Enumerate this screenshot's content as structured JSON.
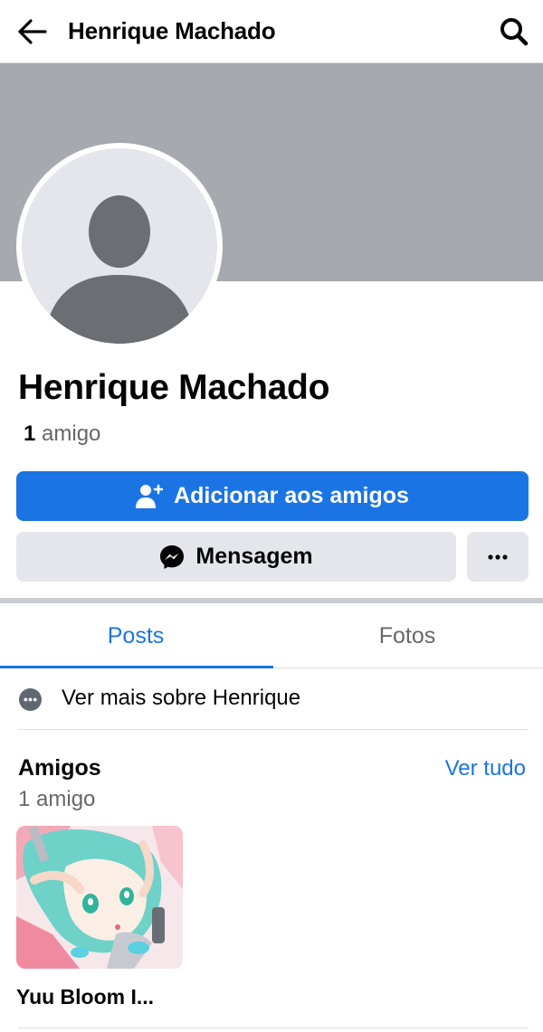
{
  "header": {
    "title": "Henrique Machado",
    "back_icon": "arrow-left-icon",
    "search_icon": "search-icon"
  },
  "profile": {
    "name": "Henrique Machado",
    "friend_count_number": "1",
    "friend_count_word": "amigo",
    "cover_color": "#a6a9ae",
    "avatar_icon": "default-avatar-icon"
  },
  "actions": {
    "add_friend_label": "Adicionar aos amigos",
    "add_friend_icon": "person-add-icon",
    "message_label": "Mensagem",
    "message_icon": "messenger-icon",
    "more_icon": "ellipsis-icon"
  },
  "tabs": [
    {
      "label": "Posts",
      "active": true
    },
    {
      "label": "Fotos",
      "active": false
    }
  ],
  "about": {
    "label": "Ver mais sobre Henrique",
    "icon": "ellipsis-circle-icon"
  },
  "friends": {
    "title": "Amigos",
    "see_all_label": "Ver tudo",
    "subtitle": "1 amigo",
    "items": [
      {
        "name": "Yuu Bloom I..."
      }
    ]
  },
  "colors": {
    "accent": "#1b74e4",
    "secondary_button": "#e4e6eb",
    "muted_text": "#65676b"
  }
}
